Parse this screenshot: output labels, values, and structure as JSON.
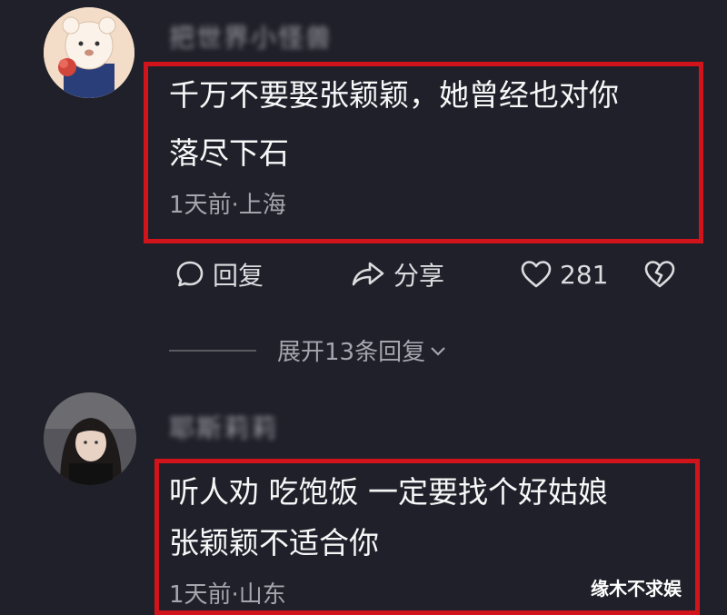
{
  "comment1": {
    "username": "把世界小怪兽",
    "text_line1": "千万不要娶张颖颖，她曾经也对你",
    "text_line2": "落尽下石",
    "meta": "1天前·上海"
  },
  "actions": {
    "reply_label": "回复",
    "share_label": "分享",
    "like_count": "281"
  },
  "expand": {
    "label": "展开13条回复"
  },
  "comment2": {
    "username": "耶斯莉莉",
    "text_line1": "听人劝 吃饱饭 一定要找个好姑娘",
    "text_line2": "张颖颖不适合你",
    "meta": "1天前·山东"
  },
  "watermark": "缘木不求娱",
  "colors": {
    "background": "#1f2029",
    "highlight_border": "#d1141c"
  }
}
